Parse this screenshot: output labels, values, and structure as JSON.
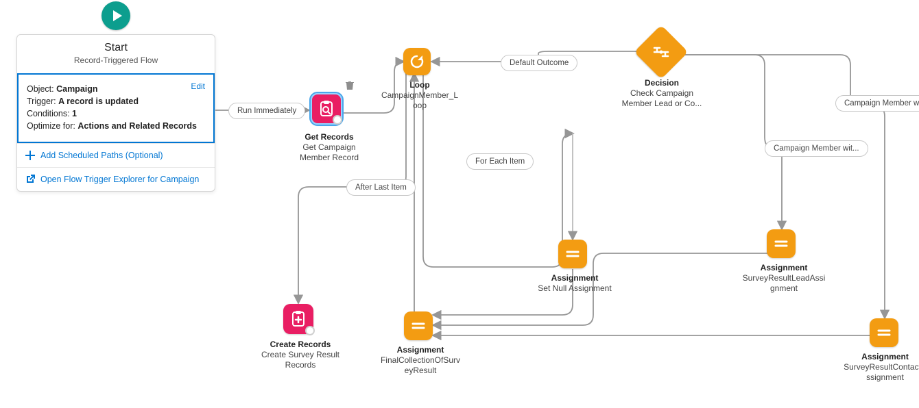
{
  "start": {
    "title": "Start",
    "subtitle": "Record-Triggered Flow",
    "object_label": "Object:",
    "object_value": "Campaign",
    "trigger_label": "Trigger:",
    "trigger_value": "A record is updated",
    "conditions_label": "Conditions:",
    "conditions_value": "1",
    "optimize_label": "Optimize for:",
    "optimize_value": "Actions and Related Records",
    "edit": "Edit",
    "add_paths": "Add Scheduled Paths (Optional)",
    "explorer": "Open Flow Trigger Explorer for Campaign"
  },
  "edges": {
    "run_immediately": "Run Immediately",
    "after_last_item": "After Last Item",
    "for_each_item": "For Each Item",
    "default_outcome": "Default Outcome",
    "cm_with_1": "Campaign Member wit...",
    "cm_with_2": "Campaign Member wit..."
  },
  "nodes": {
    "get_records": {
      "title": "Get Records",
      "sub1": "Get Campaign",
      "sub2": "Member Record"
    },
    "loop": {
      "title": "Loop",
      "sub1": "CampaignMember_L",
      "sub2": "oop"
    },
    "decision": {
      "title": "Decision",
      "sub1": "Check Campaign",
      "sub2": "Member Lead or Co..."
    },
    "assign_null": {
      "title": "Assignment",
      "sub1": "Set Null Assignment"
    },
    "assign_lead": {
      "title": "Assignment",
      "sub1": "SurveyResultLeadAssi",
      "sub2": "gnment"
    },
    "assign_contact": {
      "title": "Assignment",
      "sub1": "SurveyResultContactA",
      "sub2": "ssignment"
    },
    "assign_final": {
      "title": "Assignment",
      "sub1": "FinalCollectionOfSurv",
      "sub2": "eyResult"
    },
    "create_records": {
      "title": "Create Records",
      "sub1": "Create Survey Result",
      "sub2": "Records"
    }
  },
  "icons": {
    "play": "play-icon",
    "plus": "plus-icon",
    "external": "external-link-icon",
    "trash": "trash-icon",
    "search_clipboard": "get-records-icon",
    "loop": "loop-icon",
    "decision": "decision-icon",
    "assignment": "assignment-icon",
    "create": "create-records-icon"
  }
}
